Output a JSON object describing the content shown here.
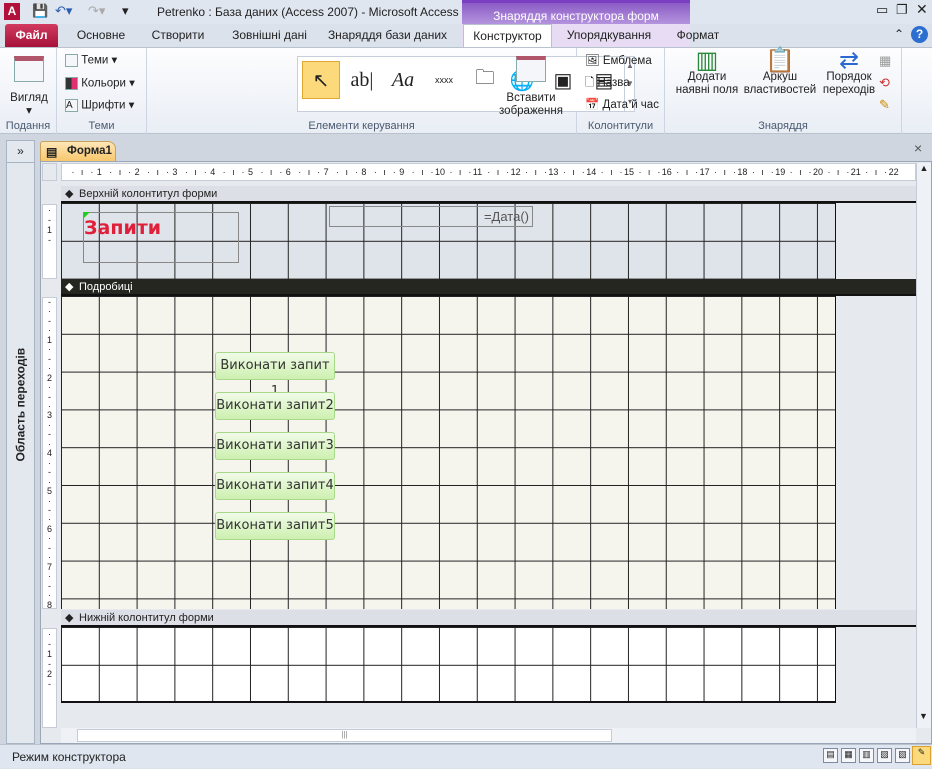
{
  "title": "Petrenko : База даних (Access 2007)  -  Microsoft Access",
  "contextual_tab": "Знаряддя конструктора форм",
  "tabs": [
    "Файл",
    "Основне",
    "Створити",
    "Зовнішні дані",
    "Знаряддя бази даних",
    "Конструктор",
    "Упорядкування",
    "Формат"
  ],
  "ribbon": {
    "views": {
      "button": "Вигляд",
      "label": "Подання"
    },
    "themes": {
      "items": [
        "Теми",
        "Кольори",
        "Шрифти"
      ],
      "label": "Теми"
    },
    "controls": {
      "label": "Елементи керування",
      "insert_image": "Вставити зображення"
    },
    "header_footer": {
      "items": [
        "Емблема",
        "Назва",
        "Дата й час"
      ],
      "label": "Колонтитули"
    },
    "tools": {
      "add_fields": "Додати наявні поля",
      "property_sheet": "Аркуш властивостей",
      "tab_order": "Порядок переходів",
      "label": "Знаряддя"
    }
  },
  "nav_pane": {
    "label": "Область переходів",
    "toggle": "»"
  },
  "document": {
    "tab": "Форма1",
    "close": "×",
    "ruler": [
      "1",
      "2",
      "3",
      "4",
      "5",
      "6",
      "7",
      "8",
      "9",
      "10",
      "11",
      "12",
      "13",
      "14",
      "15",
      "16",
      "17",
      "18",
      "19",
      "20",
      "21",
      "22"
    ],
    "sections": {
      "header": "Верхній колонтитул форми",
      "detail": "Подробиці",
      "footer": "Нижній колонтитул форми"
    },
    "header_title": "Запити",
    "date_field": "=Дата()",
    "buttons": [
      "Виконати запит 1",
      "Виконати запит2",
      "Виконати запит3",
      "Виконати запит4",
      "Виконати запит5"
    ]
  },
  "status": {
    "text": "Режим конструктора"
  },
  "colors": {
    "accent_file": "#c0224a",
    "contextual": "#8b5cc6",
    "title_text": "#e0203a"
  }
}
